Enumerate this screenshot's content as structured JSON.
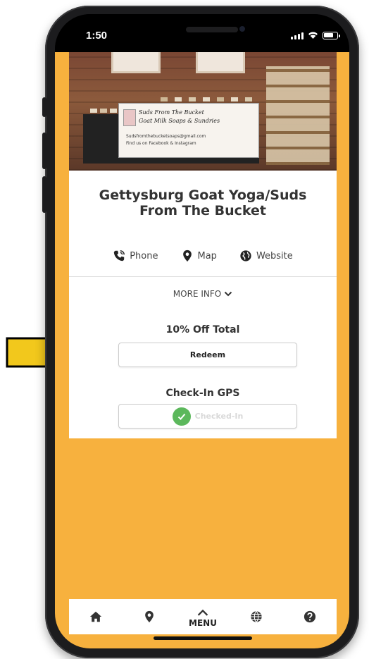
{
  "status_bar": {
    "time": "1:50"
  },
  "hero": {
    "sign_title": "Suds From The Bucket",
    "sign_subtitle": "Goat Milk Soaps & Sundries",
    "sign_email": "Sudsfromthebucketsoaps@gmail.com",
    "sign_social": "Find us on Facebook & Instagram"
  },
  "listing": {
    "title": "Gettysburg Goat Yoga/Suds From The Bucket",
    "actions": [
      {
        "label": "Phone",
        "icon": "phone-icon"
      },
      {
        "label": "Map",
        "icon": "map-marker-icon"
      },
      {
        "label": "Website",
        "icon": "globe-icon"
      }
    ],
    "more_info": "MORE INFO"
  },
  "offer": {
    "title": "10% Off Total",
    "button_label": "Redeem"
  },
  "checkin": {
    "title": "Check-In GPS",
    "status_label": "Checked-In"
  },
  "bottom_nav": {
    "menu_label": "MENU",
    "items": [
      "home-icon",
      "map-marker-icon",
      "menu",
      "globe-icon",
      "help-icon"
    ]
  },
  "colors": {
    "background": "#f7b13e",
    "arrow": "#f2c81c",
    "check": "#5cb85c"
  }
}
